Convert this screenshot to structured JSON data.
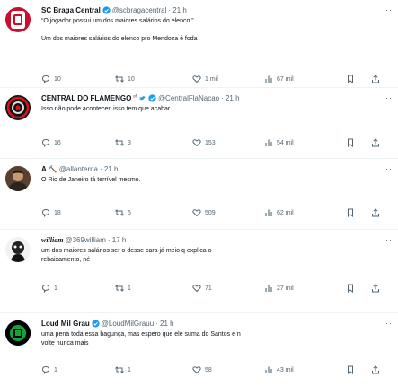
{
  "tweets": [
    {
      "name": "SC Braga Central",
      "handle": "@scbragacentral",
      "time": "· 21 h",
      "lines": [
        "“O jogador possui um dos maiores salários do elenco.”",
        "",
        "Um dos maiores salários do elenco pro Mendoza é foda"
      ],
      "replies": "10",
      "retweets": "10",
      "likes": "1 mil",
      "views": "67 mil"
    },
    {
      "name": "CENTRAL DO FLAMENGO",
      "handle": "@CentralFlaNacao",
      "time": "· 21 h",
      "lines": [
        "Isso não pode acontecer, isso tem que acabar..."
      ],
      "replies": "16",
      "retweets": "3",
      "likes": "153",
      "views": "54 mil"
    },
    {
      "name": "A",
      "handle": "@allanterna",
      "time": "· 21 h",
      "lines": [
        "O Rio de Janeiro tá terrível mesmo."
      ],
      "replies": "18",
      "retweets": "5",
      "likes": "509",
      "views": "62 mil"
    },
    {
      "name": "william",
      "handle": "@369william",
      "time": "· 17 h",
      "lines": [
        "um dos maiores salários ser o desse cara já meio q explica o",
        "rebaixamento, né"
      ],
      "replies": "1",
      "retweets": "1",
      "likes": "71",
      "views": "27 mil"
    },
    {
      "name": "Loud Mil Grau",
      "handle": "@LoudMilGrauu",
      "time": "· 21 h",
      "lines": [
        "uma pena toda essa bagunça, mas espero que ele suma do Santos e n",
        "volte nunca mais"
      ],
      "replies": "1",
      "retweets": "1",
      "likes": "58",
      "views": "43 mil"
    }
  ],
  "colors": {
    "verified": "#1d9bf0",
    "gold": "#e2b719",
    "icon": "#536471"
  }
}
